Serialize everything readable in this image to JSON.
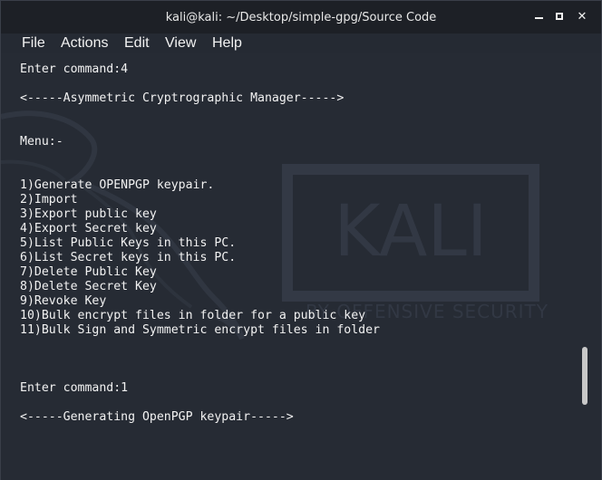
{
  "window": {
    "title": "kali@kali: ~/Desktop/simple-gpg/Source Code",
    "minimize_label": "",
    "maximize_label": "",
    "close_label": "✕"
  },
  "menu": [
    "File",
    "Actions",
    "Edit",
    "View",
    "Help"
  ],
  "watermark": {
    "brand": "KALI",
    "tagline": "BY OFFENSIVE SECURITY"
  },
  "terminal": {
    "lines": [
      "Enter command:4",
      "",
      "<-----Asymmetric Cryptrographic Manager----->",
      "",
      "",
      "Menu:-",
      "",
      "",
      "1)Generate OPENPGP keypair.",
      "2)Import",
      "3)Export public key",
      "4)Export Secret key",
      "5)List Public Keys in this PC.",
      "6)List Secret keys in this PC.",
      "7)Delete Public Key",
      "8)Delete Secret Key",
      "9)Revoke Key",
      "10)Bulk encrypt files in folder for a public key",
      "11)Bulk Sign and Symmetric encrypt files in folder",
      "",
      "",
      "",
      "Enter command:1",
      "",
      "<-----Generating OpenPGP keypair----->"
    ]
  }
}
